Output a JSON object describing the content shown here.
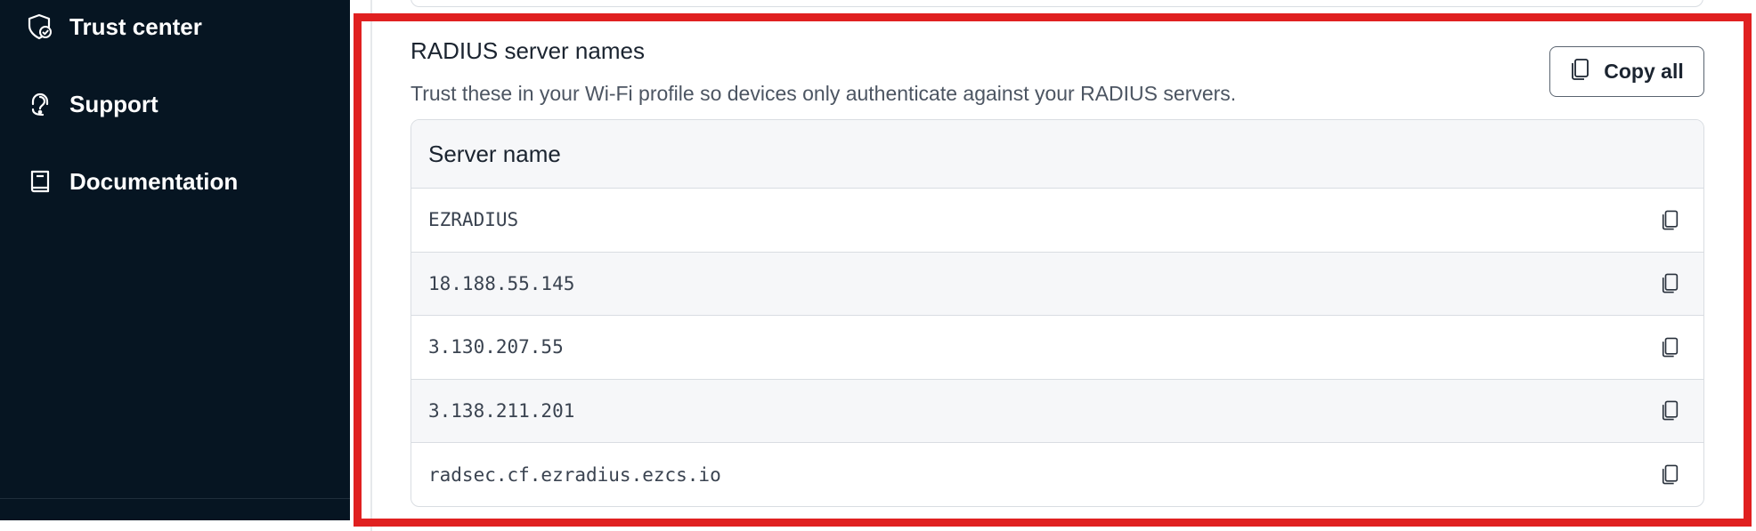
{
  "sidebar": {
    "items": [
      {
        "label": "Trust center",
        "icon": "shield-check-icon"
      },
      {
        "label": "Support",
        "icon": "headset-icon"
      },
      {
        "label": "Documentation",
        "icon": "book-icon"
      }
    ]
  },
  "section": {
    "title": "RADIUS server names",
    "description": "Trust these in your Wi-Fi profile so devices only authenticate against your RADIUS servers.",
    "copy_all_label": "Copy all"
  },
  "table": {
    "header": "Server name",
    "rows": [
      {
        "value": "EZRADIUS"
      },
      {
        "value": "18.188.55.145"
      },
      {
        "value": "3.130.207.55"
      },
      {
        "value": "3.138.211.201"
      },
      {
        "value": "radsec.cf.ezradius.ezcs.io"
      }
    ]
  },
  "colors": {
    "sidebar_bg": "#061522",
    "highlight": "#e02020",
    "text_primary": "#1b2430",
    "text_secondary": "#4c5562"
  }
}
